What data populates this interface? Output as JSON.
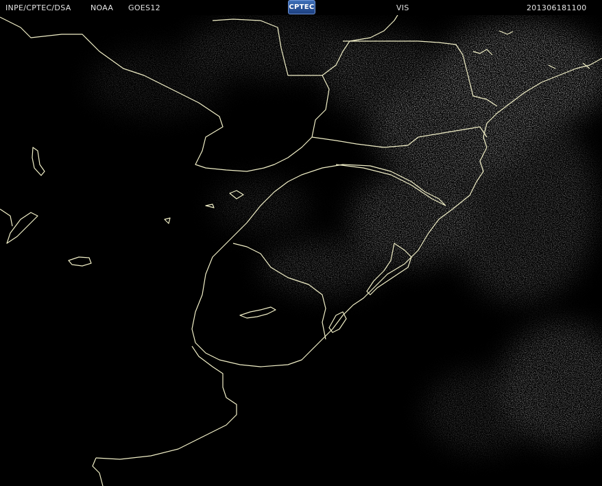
{
  "header": {
    "source": "INPE/CPTEC/DSA",
    "agency": "NOAA",
    "satellite": "GOES12",
    "logo_text": "CPTEC",
    "channel": "VIS",
    "timestamp": "201306181100"
  },
  "colors": {
    "background": "#000000",
    "coastline": "#f2f0c8",
    "cloud": "#9a9a9a",
    "header_text": "#e6e6e6"
  }
}
